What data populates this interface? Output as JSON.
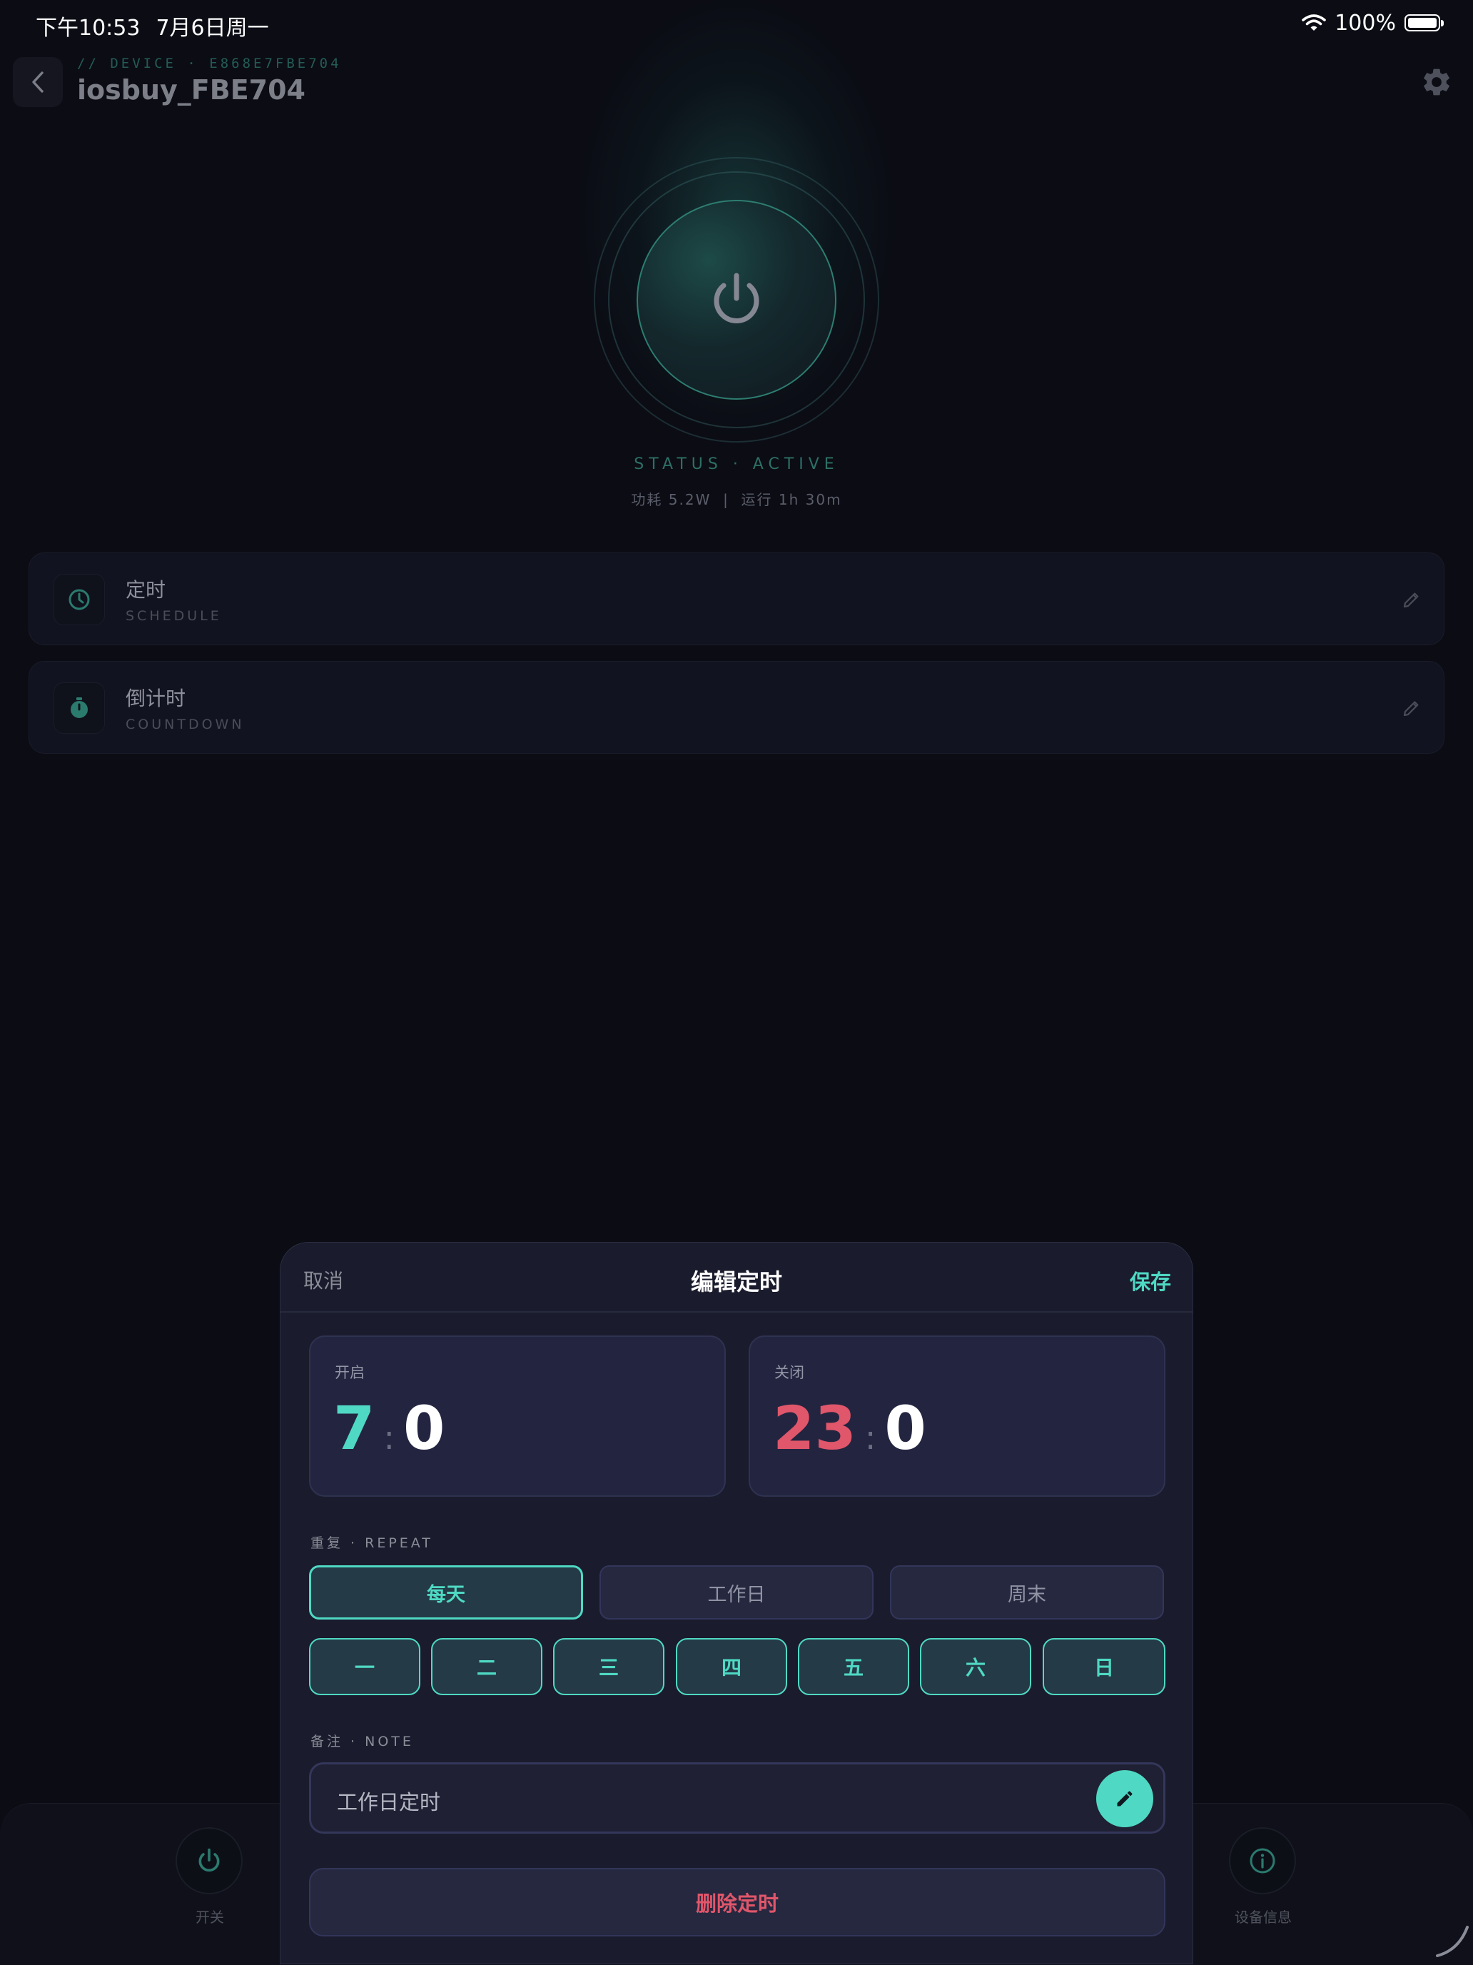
{
  "status_bar": {
    "time": "下午10:53",
    "date": "7月6日周一",
    "battery": "100%"
  },
  "header": {
    "device_id": "// DEVICE · E868E7FBE704",
    "device_name": "iosbuy_FBE704"
  },
  "power": {
    "status": "STATUS · ACTIVE",
    "stats": "功耗 5.2W  |  运行 1h 30m"
  },
  "cards": [
    {
      "title": "定时",
      "subtitle": "SCHEDULE",
      "icon": "clock-icon"
    },
    {
      "title": "倒计时",
      "subtitle": "COUNTDOWN",
      "icon": "stopwatch-icon"
    }
  ],
  "tabbar": {
    "items": [
      {
        "label": "开关",
        "icon": "power-icon"
      },
      {
        "label": "设备信息",
        "icon": "info-icon"
      }
    ]
  },
  "sheet": {
    "cancel": "取消",
    "title": "编辑定时",
    "save": "保存",
    "on": {
      "label": "开启",
      "hour": "7",
      "sep": ":",
      "minute": "0"
    },
    "off": {
      "label": "关闭",
      "hour": "23",
      "sep": ":",
      "minute": "0"
    },
    "repeat_label": "重复 · REPEAT",
    "presets": [
      {
        "label": "每天",
        "selected": true
      },
      {
        "label": "工作日",
        "selected": false
      },
      {
        "label": "周末",
        "selected": false
      }
    ],
    "days": [
      "一",
      "二",
      "三",
      "四",
      "五",
      "六",
      "日"
    ],
    "note_label": "备注 · NOTE",
    "note_value": "工作日定时",
    "delete": "删除定时"
  },
  "colors": {
    "accent": "#4fd9c4",
    "danger": "#e0566a",
    "background": "#0b0c14",
    "sheet": "#1a1b2c"
  }
}
